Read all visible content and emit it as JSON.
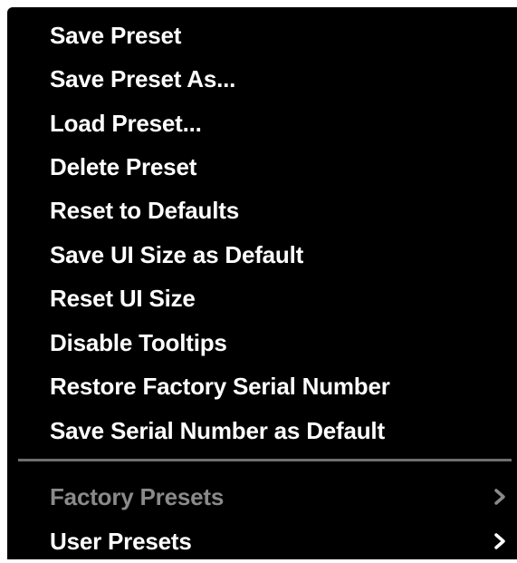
{
  "menu": {
    "items": [
      {
        "label": "Save Preset",
        "enabled": true
      },
      {
        "label": "Save Preset As...",
        "enabled": true
      },
      {
        "label": "Load Preset...",
        "enabled": true
      },
      {
        "label": "Delete Preset",
        "enabled": true
      },
      {
        "label": "Reset to Defaults",
        "enabled": true
      },
      {
        "label": "Save UI Size as Default",
        "enabled": true
      },
      {
        "label": "Reset UI Size",
        "enabled": true
      },
      {
        "label": "Disable Tooltips",
        "enabled": true
      },
      {
        "label": "Restore Factory Serial Number",
        "enabled": true
      },
      {
        "label": "Save Serial Number as Default",
        "enabled": true
      }
    ],
    "submenus": [
      {
        "label": "Factory Presets",
        "enabled": false,
        "icon": "chevron-right-icon"
      },
      {
        "label": "User Presets",
        "enabled": true,
        "icon": "chevron-right-icon"
      }
    ]
  },
  "colors": {
    "background": "#000000",
    "text": "#ffffff",
    "disabled_text": "#8a8a8a",
    "separator": "#6e6e6e"
  }
}
